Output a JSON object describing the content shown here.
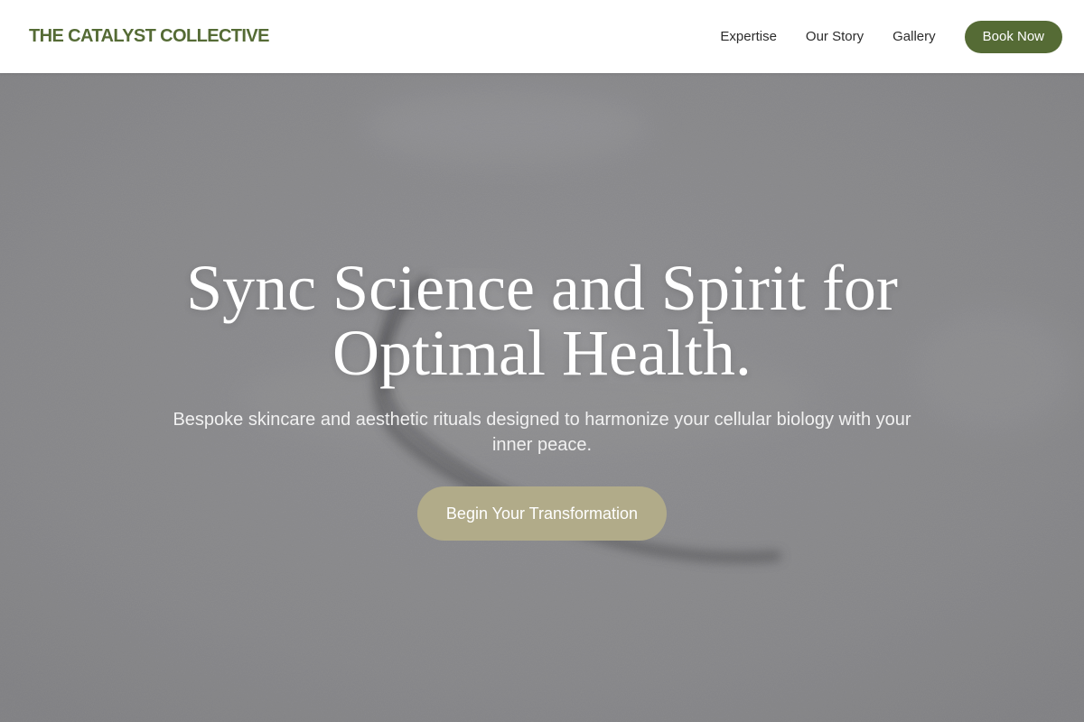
{
  "header": {
    "brand": "THE CATALYST COLLECTIVE",
    "nav": [
      {
        "label": "Expertise"
      },
      {
        "label": "Our Story"
      },
      {
        "label": "Gallery"
      }
    ],
    "book_button": "Book Now"
  },
  "hero": {
    "title": "Sync Science and Spirit for Optimal Health.",
    "subtitle": "Bespoke skincare and aesthetic rituals designed to harmonize your cellular biology with your inner peace.",
    "cta": "Begin Your Transformation"
  },
  "colors": {
    "brand_green": "#556b35",
    "cta_khaki": "#b1ab89",
    "hero_gray": "#8b8b8d"
  }
}
